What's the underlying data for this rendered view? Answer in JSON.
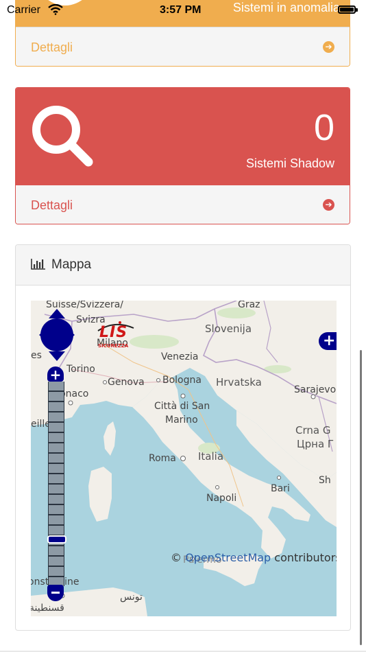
{
  "status_bar": {
    "carrier": "Carrier",
    "time": "3:57 PM"
  },
  "anomaly_panel": {
    "title": "Sistemi in anomalia",
    "details_label": "Dettagli",
    "color": "#f0ad4e"
  },
  "shadow_panel": {
    "count": "0",
    "label": "Sistemi Shadow",
    "details_label": "Dettagli",
    "color": "#d9534f",
    "icon": "search-icon"
  },
  "map_panel": {
    "title": "Mappa",
    "icon": "bar-chart-icon",
    "logo_text": "LIS",
    "logo_subtext": "SICUREZZA",
    "attribution_prefix": "© ",
    "attribution_link": "OpenStreetMap",
    "attribution_suffix": " contributors",
    "places": {
      "suisse": "Suisse/Svizzera/",
      "svizra": "Svizra",
      "graz": "Graz",
      "slovenija": "Slovenija",
      "milano": "Milano",
      "venezia": "Venezia",
      "torino": "Torino",
      "genova": "Genova",
      "bologna": "Bologna",
      "hrvatska": "Hrvatska",
      "sarajevo": "Sarajevo",
      "monaco": "Monaco",
      "citta_di_san": "Città di San",
      "marino": "Marino",
      "crna_g": "Crna G",
      "crna_cyr": "Црна Г",
      "roma": "Roma",
      "italia": "Italia",
      "bari": "Bari",
      "napoli": "Napoli",
      "palermo": "Palermo",
      "constantine": "onstantine",
      "tunis": "تونس",
      "qusantina": "قسنطينة",
      "es": "es",
      "eille": "eille",
      "sh": "Sh"
    }
  }
}
